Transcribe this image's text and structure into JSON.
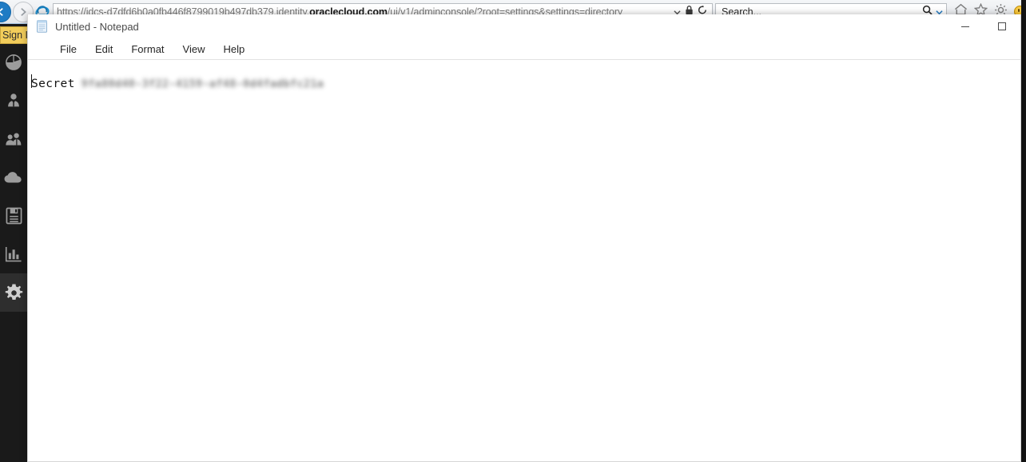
{
  "browser": {
    "name": "internet-explorer",
    "url_prefix": "https://",
    "url_host_dim": "idcs-d7dfd6b0a0fb446f8799019b497db379.identity.",
    "url_host_bold": "oraclecloud.com",
    "url_path": "/ui/v1/adminconsole/?root=settings&settings=directory",
    "url_full": "https://idcs-d7dfd6b0a0fb446f8799019b497db379.identity.oraclecloud.com/ui/v1/adminconsole/?root=settings&settings=directory",
    "search_placeholder": "Search...",
    "back_label": "Back",
    "forward_label": "Forward",
    "icons": {
      "back": "back-arrow-icon",
      "forward": "forward-arrow-icon",
      "ie_logo": "internet-explorer-logo-icon",
      "dropdown": "chevron-down-icon",
      "lock": "lock-icon",
      "refresh": "refresh-icon",
      "search": "search-icon",
      "home": "home-icon",
      "favorites": "star-icon",
      "tools": "gear-icon",
      "feedback": "smiley-icon"
    }
  },
  "console": {
    "signin_label": "Sign In",
    "sidebar": {
      "items": [
        {
          "name": "dashboard",
          "icon": "pie-chart-icon",
          "active": false
        },
        {
          "name": "users",
          "icon": "user-icon",
          "active": false
        },
        {
          "name": "groups",
          "icon": "users-group-icon",
          "active": false
        },
        {
          "name": "applications",
          "icon": "cloud-icon",
          "active": false
        },
        {
          "name": "jobs",
          "icon": "floppy-disk-icon",
          "active": false
        },
        {
          "name": "reports",
          "icon": "bar-chart-icon",
          "active": false
        },
        {
          "name": "settings",
          "icon": "gear-icon",
          "active": true
        }
      ]
    }
  },
  "notepad": {
    "title": "Untitled - Notepad",
    "icon": "notepad-icon",
    "menu": [
      "File",
      "Edit",
      "Format",
      "View",
      "Help"
    ],
    "window_buttons": {
      "minimize": "minimize-button",
      "maximize": "maximize-button"
    },
    "content": {
      "label": "Secret",
      "value": "9fa80d40-3f22-4159-af48-0d4fadbfc21a",
      "value_redacted": true
    }
  }
}
